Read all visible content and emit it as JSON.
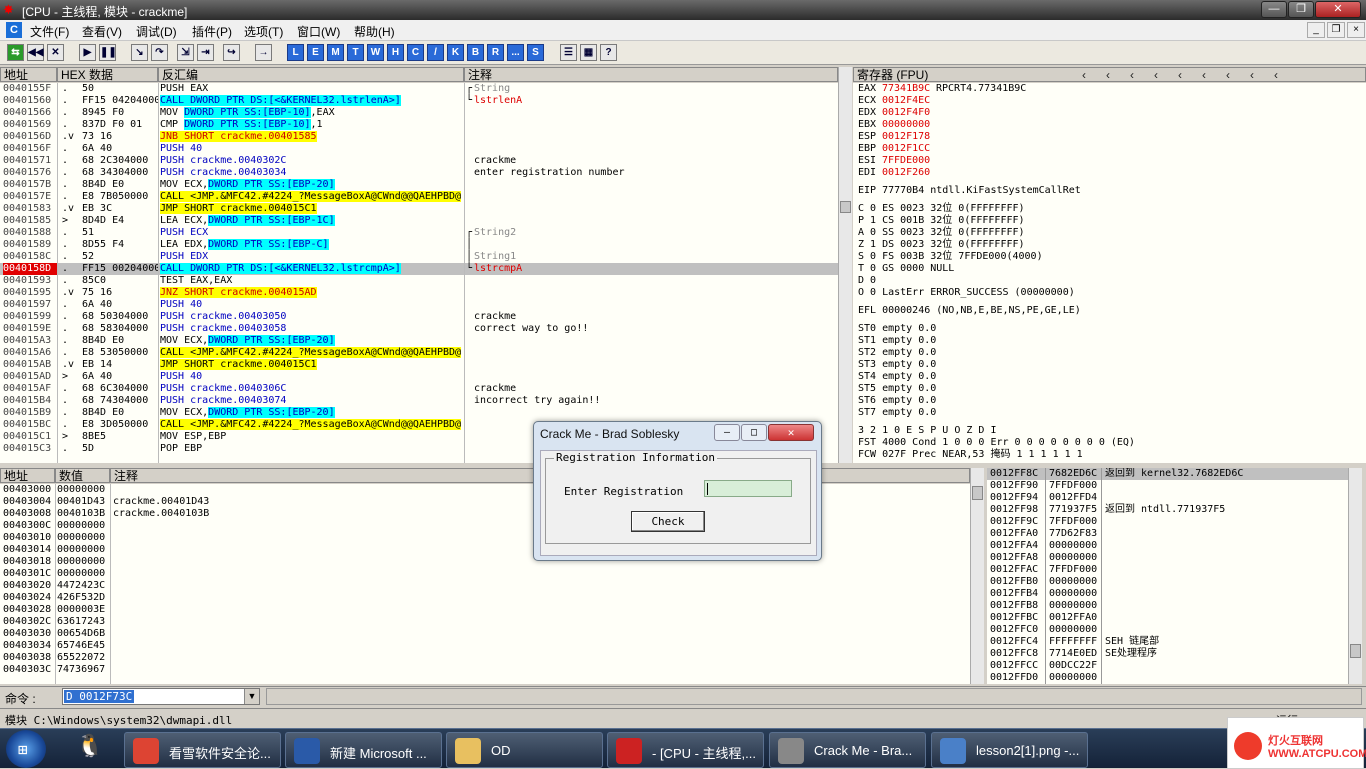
{
  "window": {
    "title": "[CPU - 主线程, 模块 - crackme]"
  },
  "menu": [
    "文件(F)",
    "查看(V)",
    "调试(D)",
    "插件(P)",
    "选项(T)",
    "窗口(W)",
    "帮助(H)"
  ],
  "toolbar": {
    "letters": [
      "L",
      "E",
      "M",
      "T",
      "W",
      "H",
      "C",
      "/",
      "K",
      "B",
      "R",
      "...",
      "S"
    ]
  },
  "disasm": {
    "headers": {
      "addr": "地址",
      "hex": "HEX 数据",
      "dis": "反汇编",
      "comment": "注释"
    },
    "rows": [
      {
        "addr": "0040155F",
        "m": ".",
        "hex": "50",
        "asm": "PUSH EAX",
        "c": "String",
        "cc": "gr",
        "bk": "┌"
      },
      {
        "addr": "00401560",
        "m": ".",
        "hex": "FF15 04204000",
        "asm": "CALL DWORD PTR DS:[<&KERNEL32.lstrlenA>]",
        "st": "cy",
        "c": "lstrlenA",
        "cc": "rd",
        "bk": "└"
      },
      {
        "addr": "00401566",
        "m": ".",
        "hex": "8945 F0",
        "asm": "MOV DWORD PTR SS:[EBP-10],EAX",
        "op": "DWORD PTR SS:[EBP-10]",
        "pre": "MOV ",
        "post": ",EAX"
      },
      {
        "addr": "00401569",
        "m": ".",
        "hex": "837D F0 01",
        "asm": "CMP DWORD PTR SS:[EBP-10],1",
        "op": "DWORD PTR SS:[EBP-10]",
        "pre": "CMP ",
        "post": ",1"
      },
      {
        "addr": "0040156D",
        "m": ".v",
        "hex": "73 16",
        "asm": "JNB SHORT crackme.00401585",
        "st": "jnb"
      },
      {
        "addr": "0040156F",
        "m": ".",
        "hex": "6A 40",
        "asm": "PUSH 40",
        "st": "push"
      },
      {
        "addr": "00401571",
        "m": ".",
        "hex": "68 2C304000",
        "asm": "PUSH crackme.0040302C",
        "st": "pushy",
        "c": "crackme",
        "cc": ""
      },
      {
        "addr": "00401576",
        "m": ".",
        "hex": "68 34304000",
        "asm": "PUSH crackme.00403034",
        "st": "pushy",
        "c": "enter registration number",
        "cc": ""
      },
      {
        "addr": "0040157B",
        "m": ".",
        "hex": "8B4D E0",
        "asm": "MOV ECX,DWORD PTR SS:[EBP-20]",
        "op": "DWORD PTR SS:[EBP-20]",
        "pre": "MOV ECX,",
        "post": ""
      },
      {
        "addr": "0040157E",
        "m": ".",
        "hex": "E8 7B050000",
        "asm": "CALL <JMP.&MFC42.#4224_?MessageBoxA@CWnd@@QAEHPBD@",
        "st": "cally"
      },
      {
        "addr": "00401583",
        "m": ".v",
        "hex": "EB 3C",
        "asm": "JMP SHORT crackme.004015C1",
        "st": "y"
      },
      {
        "addr": "00401585",
        "m": ">",
        "hex": "8D4D E4",
        "asm": "LEA ECX,DWORD PTR SS:[EBP-1C]",
        "op": "DWORD PTR SS:[EBP-1C]",
        "pre": "LEA ECX,",
        "post": ""
      },
      {
        "addr": "00401588",
        "m": ".",
        "hex": "51",
        "asm": "PUSH ECX",
        "st": "push",
        "c": "String2",
        "cc": "gr",
        "bk": "┌"
      },
      {
        "addr": "00401589",
        "m": ".",
        "hex": "8D55 F4",
        "asm": "LEA EDX,DWORD PTR SS:[EBP-C]",
        "op": "DWORD PTR SS:[EBP-C]",
        "pre": "LEA EDX,",
        "post": "",
        "bk": "│"
      },
      {
        "addr": "0040158C",
        "m": ".",
        "hex": "52",
        "asm": "PUSH EDX",
        "st": "push",
        "c": "String1",
        "cc": "gr",
        "bk": "│"
      },
      {
        "addr": "0040158D",
        "m": ".",
        "hex": "FF15 00204000",
        "asm": "CALL DWORD PTR DS:[<&KERNEL32.lstrcmpA>]",
        "st": "cy",
        "c": "lstrcmpA",
        "cc": "rd",
        "bk": "└",
        "sel": true
      },
      {
        "addr": "00401593",
        "m": ".",
        "hex": "85C0",
        "asm": "TEST EAX,EAX"
      },
      {
        "addr": "00401595",
        "m": ".v",
        "hex": "75 16",
        "asm": "JNZ SHORT crackme.004015AD",
        "st": "jnb"
      },
      {
        "addr": "00401597",
        "m": ".",
        "hex": "6A 40",
        "asm": "PUSH 40",
        "st": "push"
      },
      {
        "addr": "00401599",
        "m": ".",
        "hex": "68 50304000",
        "asm": "PUSH crackme.00403050",
        "st": "pushy",
        "c": "crackme",
        "cc": ""
      },
      {
        "addr": "0040159E",
        "m": ".",
        "hex": "68 58304000",
        "asm": "PUSH crackme.00403058",
        "st": "pushy",
        "c": "correct way to go!!",
        "cc": ""
      },
      {
        "addr": "004015A3",
        "m": ".",
        "hex": "8B4D E0",
        "asm": "MOV ECX,DWORD PTR SS:[EBP-20]",
        "op": "DWORD PTR SS:[EBP-20]",
        "pre": "MOV ECX,",
        "post": ""
      },
      {
        "addr": "004015A6",
        "m": ".",
        "hex": "E8 53050000",
        "asm": "CALL <JMP.&MFC42.#4224_?MessageBoxA@CWnd@@QAEHPBD@",
        "st": "cally"
      },
      {
        "addr": "004015AB",
        "m": ".v",
        "hex": "EB 14",
        "asm": "JMP SHORT crackme.004015C1",
        "st": "y"
      },
      {
        "addr": "004015AD",
        "m": ">",
        "hex": "6A 40",
        "asm": "PUSH 40",
        "st": "push"
      },
      {
        "addr": "004015AF",
        "m": ".",
        "hex": "68 6C304000",
        "asm": "PUSH crackme.0040306C",
        "st": "pushy",
        "c": "crackme",
        "cc": ""
      },
      {
        "addr": "004015B4",
        "m": ".",
        "hex": "68 74304000",
        "asm": "PUSH crackme.00403074",
        "st": "pushy",
        "c": "incorrect try again!!",
        "cc": ""
      },
      {
        "addr": "004015B9",
        "m": ".",
        "hex": "8B4D E0",
        "asm": "MOV ECX,DWORD PTR SS:[EBP-20]",
        "op": "DWORD PTR SS:[EBP-20]",
        "pre": "MOV ECX,",
        "post": ""
      },
      {
        "addr": "004015BC",
        "m": ".",
        "hex": "E8 3D050000",
        "asm": "CALL <JMP.&MFC42.#4224_?MessageBoxA@CWnd@@QAEHPBD@",
        "st": "cally"
      },
      {
        "addr": "004015C1",
        "m": ">",
        "hex": "8BE5",
        "asm": "MOV ESP,EBP"
      },
      {
        "addr": "004015C3",
        "m": ".",
        "hex": "5D",
        "asm": "POP EBP"
      }
    ]
  },
  "registers": {
    "header": "寄存器 (FPU)",
    "gp": [
      [
        "EAX",
        "77341B9C",
        "RPCRT4.77341B9C"
      ],
      [
        "ECX",
        "0012F4EC",
        ""
      ],
      [
        "EDX",
        "0012F4F0",
        ""
      ],
      [
        "EBX",
        "00000000",
        ""
      ],
      [
        "ESP",
        "0012F178",
        ""
      ],
      [
        "EBP",
        "0012F1CC",
        ""
      ],
      [
        "ESI",
        "7FFDE000",
        ""
      ],
      [
        "EDI",
        "0012F260",
        ""
      ]
    ],
    "eip": "EIP 77770B4 ntdll.KiFastSystemCallRet",
    "flags": [
      "C 0  ES 0023 32位 0(FFFFFFFF)",
      "P 1  CS 001B 32位 0(FFFFFFFF)",
      "A 0  SS 0023 32位 0(FFFFFFFF)",
      "Z 1  DS 0023 32位 0(FFFFFFFF)",
      "S 0  FS 003B 32位 7FFDE000(4000)",
      "T 0  GS 0000 NULL",
      "D 0",
      "O 0  LastErr ERROR_SUCCESS (00000000)"
    ],
    "efl": "EFL 00000246 (NO,NB,E,BE,NS,PE,GE,LE)",
    "st": [
      "ST0 empty 0.0",
      "ST1 empty 0.0",
      "ST2 empty 0.0",
      "ST3 empty 0.0",
      "ST4 empty 0.0",
      "ST5 empty 0.0",
      "ST6 empty 0.0",
      "ST7 empty 0.0"
    ],
    "fpu1": "           3 2 1 0      E S P U O Z D I",
    "fst": "FST 4000  Cond 1 0 0 0  Err 0 0 0 0 0 0 0 0  (EQ)",
    "fcw": "FCW 027F  Prec NEAR,53  掩码    1 1 1 1 1 1"
  },
  "dump": {
    "headers": {
      "addr": "地址",
      "val": "数值",
      "comment": "注释"
    },
    "rows": [
      [
        "00403000",
        "00000000",
        ""
      ],
      [
        "00403004",
        "00401D43",
        "crackme.00401D43"
      ],
      [
        "00403008",
        "0040103B",
        "crackme.0040103B"
      ],
      [
        "0040300C",
        "00000000",
        ""
      ],
      [
        "00403010",
        "00000000",
        ""
      ],
      [
        "00403014",
        "00000000",
        ""
      ],
      [
        "00403018",
        "00000000",
        ""
      ],
      [
        "0040301C",
        "00000000",
        ""
      ],
      [
        "00403020",
        "4472423C",
        ""
      ],
      [
        "00403024",
        "426F532D",
        ""
      ],
      [
        "00403028",
        "0000003E",
        ""
      ],
      [
        "0040302C",
        "63617243",
        ""
      ],
      [
        "00403030",
        "00654D6B",
        ""
      ],
      [
        "00403034",
        "65746E45",
        ""
      ],
      [
        "00403038",
        "65522072",
        ""
      ],
      [
        "0040303C",
        "74736967",
        ""
      ]
    ]
  },
  "stack": {
    "rows": [
      [
        "0012FF8C",
        "7682ED6C",
        "返回到 kernel32.7682ED6C"
      ],
      [
        "0012FF90",
        "7FFDF000",
        ""
      ],
      [
        "0012FF94",
        "0012FFD4",
        ""
      ],
      [
        "0012FF98",
        "771937F5",
        "返回到 ntdll.771937F5"
      ],
      [
        "0012FF9C",
        "7FFDF000",
        ""
      ],
      [
        "0012FFA0",
        "77D62F83",
        ""
      ],
      [
        "0012FFA4",
        "00000000",
        ""
      ],
      [
        "0012FFA8",
        "00000000",
        ""
      ],
      [
        "0012FFAC",
        "7FFDF000",
        ""
      ],
      [
        "0012FFB0",
        "00000000",
        ""
      ],
      [
        "0012FFB4",
        "00000000",
        ""
      ],
      [
        "0012FFB8",
        "00000000",
        ""
      ],
      [
        "0012FFBC",
        "0012FFA0",
        ""
      ],
      [
        "0012FFC0",
        "00000000",
        ""
      ],
      [
        "0012FFC4",
        "FFFFFFFF",
        "SEH 链尾部"
      ],
      [
        "0012FFC8",
        "7714E0ED",
        "SE处理程序"
      ],
      [
        "0012FFCC",
        "00DCC22F",
        ""
      ],
      [
        "0012FFD0",
        "00000000",
        ""
      ]
    ]
  },
  "command": {
    "label": "命令 :",
    "value": "D 0012F73C"
  },
  "status": "模块 C:\\Windows\\system32\\dwmapi.dll",
  "dialog": {
    "title": "Crack Me - Brad Soblesky",
    "group": "Registration Information",
    "label": "Enter Registration",
    "input": "",
    "button": "Check"
  },
  "taskbar": [
    {
      "label": "看雪软件安全论...",
      "color": "#dd4433"
    },
    {
      "label": "新建 Microsoft ...",
      "color": "#2a5aa8"
    },
    {
      "label": "OD",
      "color": "#e8c060"
    },
    {
      "label": "- [CPU - 主线程,...",
      "color": "#cc2222"
    },
    {
      "label": "Crack Me - Bra...",
      "color": "#888888"
    },
    {
      "label": "lesson2[1].png -...",
      "color": "#4a80c8"
    }
  ],
  "watermark": "灯火互联网 WWW.ATCPU.COM"
}
